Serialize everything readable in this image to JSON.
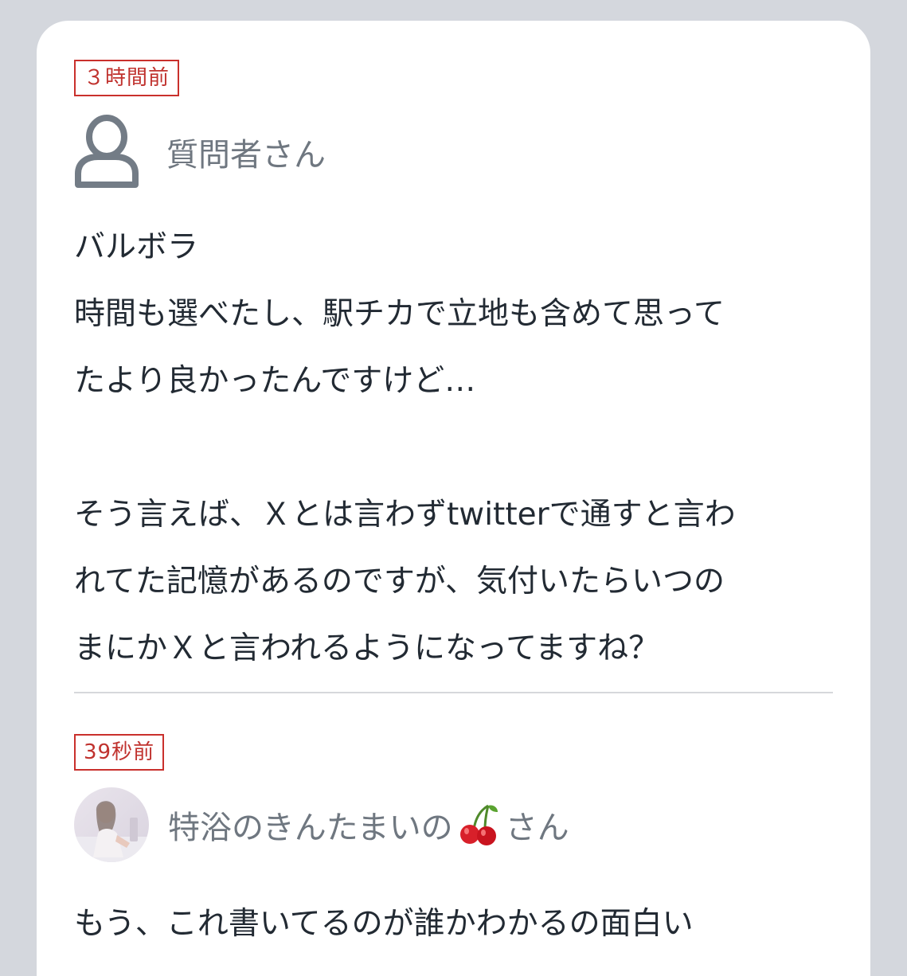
{
  "posts": [
    {
      "time": "３時間前",
      "user": "質問者さん",
      "avatar": "user-outline-icon",
      "body": "バルボラ\n時間も選べたし、駅チカで立地も含めて思って\nたより良かったんですけど…\n\nそう言えば、Ｘとは言わずtwitterで通すと言わ\nれてた記憶があるのですが、気付いたらいつの\nまにかＸと言われるようになってますね？"
    },
    {
      "time": "39秒前",
      "user_prefix": "特浴のきんたまいの",
      "user_emoji": "cherry-icon",
      "user_suffix": "さん",
      "avatar": "profile-photo",
      "body": "もう、これ書いてるのが誰かわかるの面白い"
    }
  ],
  "colors": {
    "badge": "#c0322e",
    "username": "#6f7780",
    "text": "#222a33",
    "background": "#d4d7dd",
    "card": "#ffffff"
  }
}
